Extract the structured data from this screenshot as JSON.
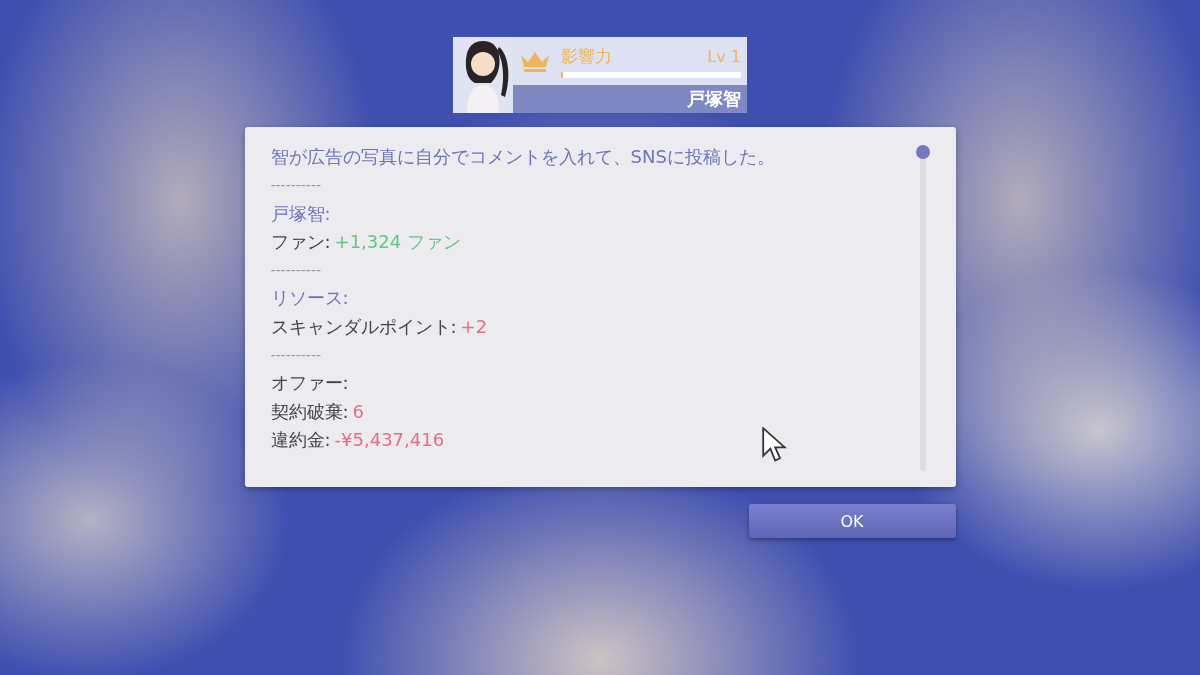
{
  "header": {
    "title": "影響力",
    "level_text": "Lv 1",
    "level": 0.01,
    "name": "戸塚智"
  },
  "message": {
    "lines": [
      {
        "kind": "title",
        "text": "智が広告の写真に自分でコメントを入れて、SNSに投稿した。"
      },
      {
        "kind": "divider",
        "text": "----------"
      },
      {
        "kind": "heading",
        "text": "戸塚智:"
      },
      {
        "kind": "stat",
        "label": "ファン:",
        "value": "+1,324 ファン",
        "color": "#5fc77e"
      },
      {
        "kind": "divider",
        "text": "----------"
      },
      {
        "kind": "heading",
        "text": "リソース:"
      },
      {
        "kind": "stat",
        "label": "スキャンダルポイント:",
        "value": "+2",
        "color": "#e56d8b"
      },
      {
        "kind": "divider",
        "text": "----------"
      },
      {
        "kind": "group",
        "text": "オファー:"
      },
      {
        "kind": "stat",
        "label": "契約破棄:",
        "value": "6",
        "color": "#e56d8b"
      },
      {
        "kind": "stat",
        "label": "違約金:",
        "value": "-¥5,437,416",
        "color": "#e56d8b"
      }
    ]
  },
  "buttons": [
    "OK"
  ]
}
